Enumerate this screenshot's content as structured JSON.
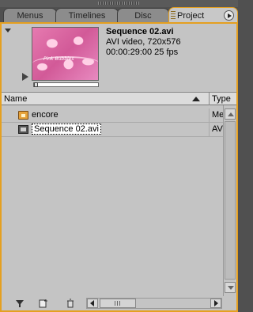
{
  "tabs": [
    {
      "label": "Menus"
    },
    {
      "label": "Timelines"
    },
    {
      "label": "Disc"
    },
    {
      "label": "Project"
    }
  ],
  "preview": {
    "thumbnail_icon": "video-thumbnail",
    "thumbnail_text": "Pink Bubbles",
    "name": "Sequence 02.avi",
    "format": "AVI video, 720x576",
    "duration": "00:00:29:00 25 fps"
  },
  "columns": {
    "name": "Name",
    "type": "Type"
  },
  "items": [
    {
      "label": "encore",
      "type": "Me",
      "icon": "folder-icon"
    },
    {
      "label": "Sequence 02.avi",
      "type": "AV",
      "icon": "avi-file-icon"
    }
  ],
  "colors": {
    "accent": "#e5a020",
    "panel": "#c4c4c4",
    "frame": "#505050"
  }
}
